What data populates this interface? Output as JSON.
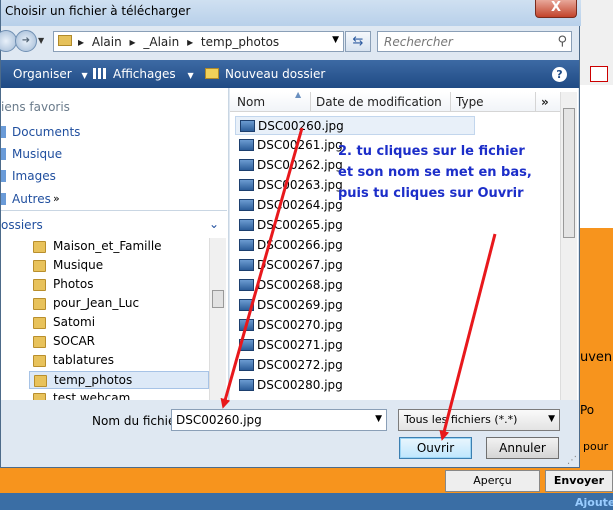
{
  "window": {
    "title": "Choisir un fichier à télécharger",
    "close_label": "X"
  },
  "address": {
    "path": [
      "Alain",
      "_Alain",
      "temp_photos"
    ],
    "separators": [
      "▸",
      "▸",
      "▸"
    ],
    "search_placeholder": "Rechercher"
  },
  "toolbar": {
    "organiser": "Organiser",
    "affichages": "Affichages",
    "nouveau_dossier": "Nouveau dossier",
    "dropdown_glyph": "▼",
    "help": "?"
  },
  "nav": {
    "favorites_label": "iens favoris",
    "favorites": [
      "Documents",
      "Musique",
      "Images",
      "Autres"
    ],
    "more": "»",
    "folders_label": "ossiers",
    "folders": [
      "Maison_et_Famille",
      "Musique",
      "Photos",
      "pour_Jean_Luc",
      "Satomi",
      "SOCAR",
      "tablatures",
      "temp_photos",
      "test webcam"
    ]
  },
  "files": {
    "columns": [
      "Nom",
      "Date de modification",
      "Type",
      "»"
    ],
    "items": [
      "DSC00260.jpg",
      "DSC00261.jpg",
      "DSC00262.jpg",
      "DSC00263.jpg",
      "DSC00264.jpg",
      "DSC00265.jpg",
      "DSC00266.jpg",
      "DSC00267.jpg",
      "DSC00268.jpg",
      "DSC00269.jpg",
      "DSC00270.jpg",
      "DSC00271.jpg",
      "DSC00272.jpg",
      "DSC00280.jpg"
    ]
  },
  "annotation": {
    "line1": "2. tu cliques sur le fichier",
    "line2": "et son nom se met en bas,",
    "line3": "puis tu cliques sur Ouvrir"
  },
  "bottom": {
    "filename_label": "Nom du fichier :",
    "filename_value": "DSC00260.jpg",
    "filetype_value": "Tous les fichiers (*.*)",
    "open": "Ouvrir",
    "cancel": "Annuler"
  },
  "background_page": {
    "word1": "uven",
    "word2": "Po",
    "word3": "pour",
    "apercu": "Aperçu",
    "envoyer": "Envoyer",
    "ajouter": "Ajouter"
  },
  "colors": {
    "annotation": "#1c2ec9",
    "arrow": "#e8181c",
    "toolbar": "#1f4a84"
  }
}
